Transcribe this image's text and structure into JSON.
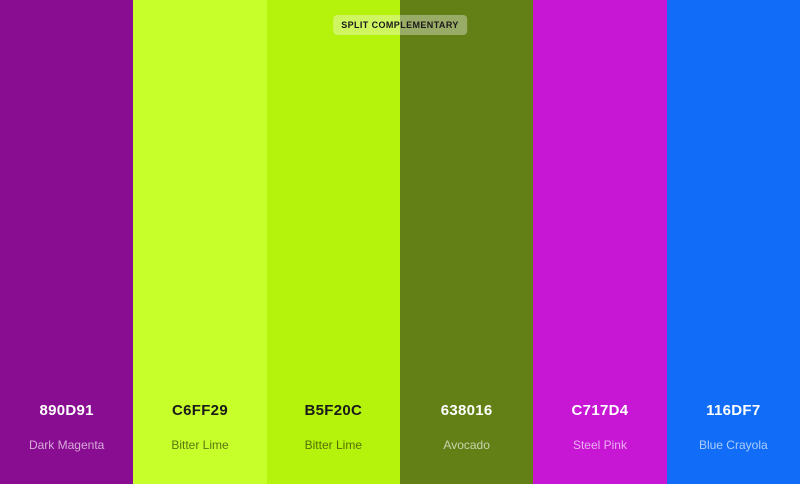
{
  "scheme": {
    "label": "SPLIT COMPLEMENTARY"
  },
  "swatches": [
    {
      "hex": "890D91",
      "name": "Dark Magenta",
      "color": "#890D91",
      "tone": "dark"
    },
    {
      "hex": "C6FF29",
      "name": "Bitter Lime",
      "color": "#C6FF29",
      "tone": "light"
    },
    {
      "hex": "B5F20C",
      "name": "Bitter Lime",
      "color": "#B5F20C",
      "tone": "light"
    },
    {
      "hex": "638016",
      "name": "Avocado",
      "color": "#638016",
      "tone": "dark"
    },
    {
      "hex": "C717D4",
      "name": "Steel Pink",
      "color": "#C717D4",
      "tone": "dark"
    },
    {
      "hex": "116DF7",
      "name": "Blue Crayola",
      "color": "#116DF7",
      "tone": "dark"
    }
  ]
}
